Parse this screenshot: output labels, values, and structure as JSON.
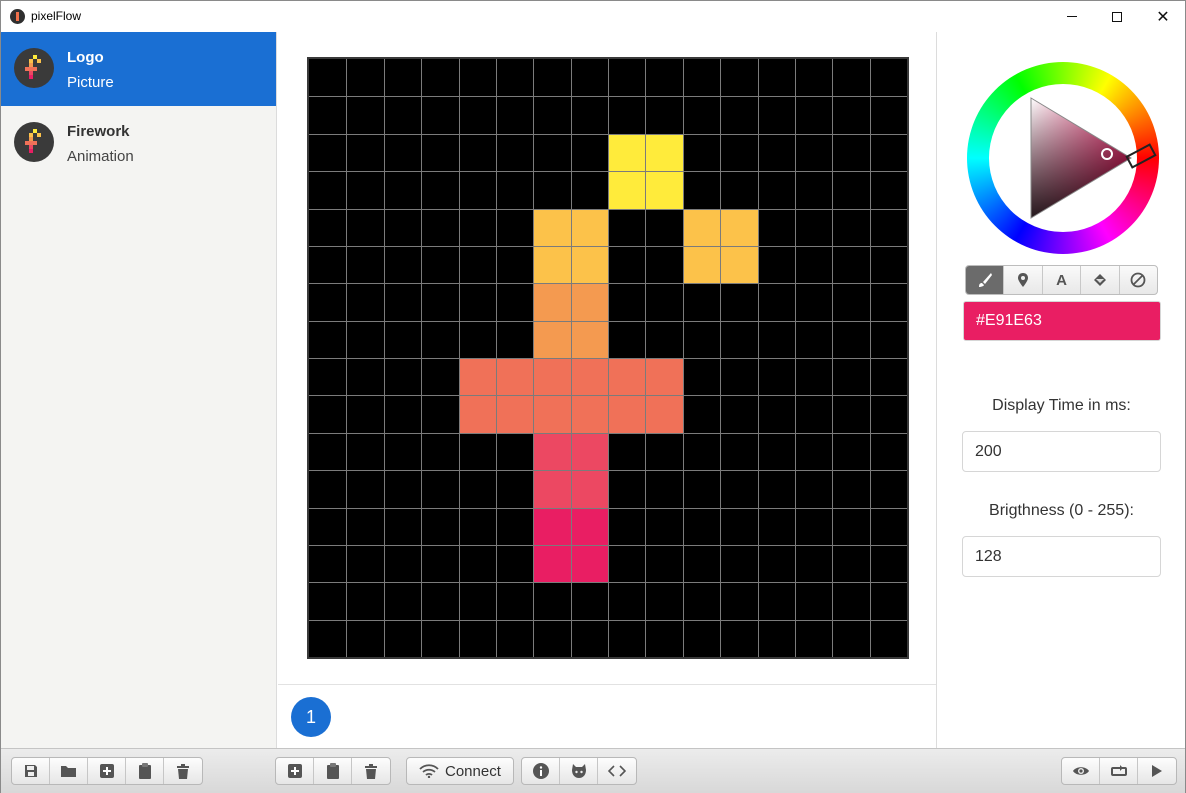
{
  "window": {
    "title": "pixelFlow"
  },
  "sidebar": {
    "items": [
      {
        "name": "Logo",
        "type": "Picture",
        "active": true
      },
      {
        "name": "Firework",
        "type": "Animation",
        "active": false
      }
    ]
  },
  "canvas": {
    "rows": 16,
    "cols": 16,
    "background": "#000000",
    "grid_color": "#7b7b7b",
    "pixels": [
      {
        "row": 2,
        "col": 8,
        "color": "#FFEB3B"
      },
      {
        "row": 2,
        "col": 9,
        "color": "#FFEB3B"
      },
      {
        "row": 3,
        "col": 8,
        "color": "#FFEB3B"
      },
      {
        "row": 3,
        "col": 9,
        "color": "#FFEB3B"
      },
      {
        "row": 4,
        "col": 6,
        "color": "#FCC24A"
      },
      {
        "row": 4,
        "col": 7,
        "color": "#FCC24A"
      },
      {
        "row": 4,
        "col": 10,
        "color": "#FCC24A"
      },
      {
        "row": 4,
        "col": 11,
        "color": "#FCC24A"
      },
      {
        "row": 5,
        "col": 6,
        "color": "#FCC24A"
      },
      {
        "row": 5,
        "col": 7,
        "color": "#FCC24A"
      },
      {
        "row": 5,
        "col": 10,
        "color": "#FCC24A"
      },
      {
        "row": 5,
        "col": 11,
        "color": "#FCC24A"
      },
      {
        "row": 6,
        "col": 6,
        "color": "#F49A50"
      },
      {
        "row": 6,
        "col": 7,
        "color": "#F49A50"
      },
      {
        "row": 7,
        "col": 6,
        "color": "#F49A50"
      },
      {
        "row": 7,
        "col": 7,
        "color": "#F49A50"
      },
      {
        "row": 8,
        "col": 4,
        "color": "#F07158"
      },
      {
        "row": 8,
        "col": 5,
        "color": "#F07158"
      },
      {
        "row": 8,
        "col": 6,
        "color": "#F07158"
      },
      {
        "row": 8,
        "col": 7,
        "color": "#F07158"
      },
      {
        "row": 8,
        "col": 8,
        "color": "#F07158"
      },
      {
        "row": 8,
        "col": 9,
        "color": "#F07158"
      },
      {
        "row": 9,
        "col": 4,
        "color": "#F07158"
      },
      {
        "row": 9,
        "col": 5,
        "color": "#F07158"
      },
      {
        "row": 9,
        "col": 6,
        "color": "#F07158"
      },
      {
        "row": 9,
        "col": 7,
        "color": "#F07158"
      },
      {
        "row": 9,
        "col": 8,
        "color": "#F07158"
      },
      {
        "row": 9,
        "col": 9,
        "color": "#F07158"
      },
      {
        "row": 10,
        "col": 6,
        "color": "#EC4862"
      },
      {
        "row": 10,
        "col": 7,
        "color": "#EC4862"
      },
      {
        "row": 11,
        "col": 6,
        "color": "#EC4862"
      },
      {
        "row": 11,
        "col": 7,
        "color": "#EC4862"
      },
      {
        "row": 12,
        "col": 6,
        "color": "#E91E63"
      },
      {
        "row": 12,
        "col": 7,
        "color": "#E91E63"
      },
      {
        "row": 13,
        "col": 6,
        "color": "#E91E63"
      },
      {
        "row": 13,
        "col": 7,
        "color": "#E91E63"
      }
    ]
  },
  "frames": [
    {
      "label": "1"
    }
  ],
  "color_picker": {
    "current_color": "#E91E63",
    "tools": [
      {
        "icon": "brush-icon",
        "active": true
      },
      {
        "icon": "map-marker-icon",
        "active": false
      },
      {
        "icon": "text-icon",
        "glyph": "A",
        "active": false
      },
      {
        "icon": "paint-bucket-icon",
        "active": false
      },
      {
        "icon": "clear-icon",
        "active": false
      }
    ]
  },
  "settings": {
    "display_time_label": "Display Time in ms:",
    "display_time_value": "200",
    "brightness_label": "Brigthness (0 - 255):",
    "brightness_value": "128"
  },
  "toolbar": {
    "file_group": [
      "save-icon",
      "folder-open-icon",
      "add-icon",
      "clipboard-icon",
      "trash-icon"
    ],
    "frame_group": [
      "add-icon",
      "clipboard-icon",
      "trash-icon"
    ],
    "connect_label": "Connect",
    "info_group": [
      "info-icon",
      "github-icon",
      "code-icon"
    ],
    "playback_group": [
      "preview-icon",
      "loop-icon",
      "play-icon"
    ]
  }
}
